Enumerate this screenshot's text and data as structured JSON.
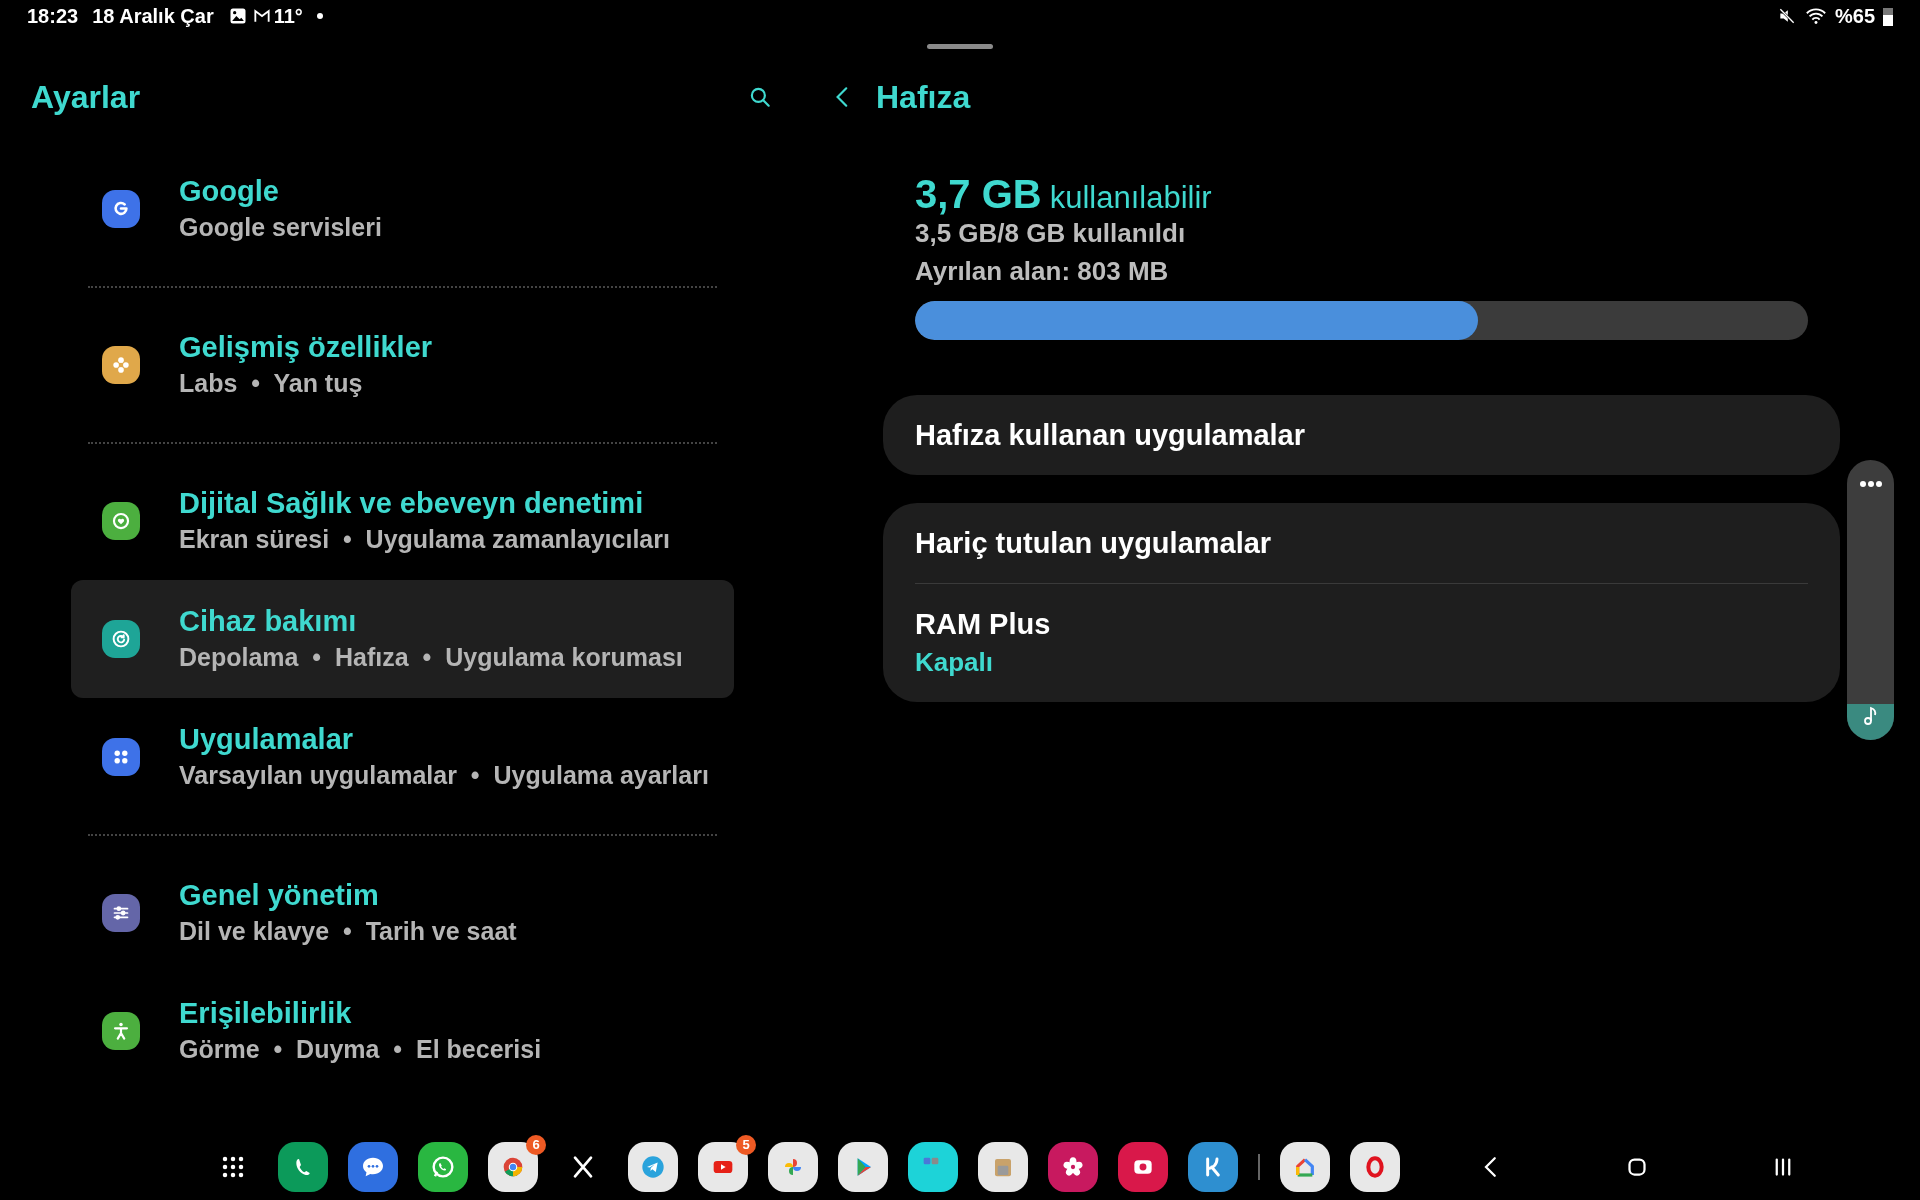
{
  "status_bar": {
    "time": "18:23",
    "date": "18 Aralık Çar",
    "temperature": "11°",
    "battery": "%65"
  },
  "settings": {
    "title": "Ayarlar",
    "groups": [
      {
        "items": [
          {
            "kind": "google",
            "title": "Google",
            "subtitle": "Google servisleri",
            "selected": false
          }
        ]
      },
      {
        "items": [
          {
            "kind": "advanced",
            "title": "Gelişmiş özellikler",
            "subtitle": "Labs  •  Yan tuş",
            "selected": false
          }
        ]
      },
      {
        "items": [
          {
            "kind": "wellbeing",
            "title": "Dijital Sağlık ve ebeveyn denetimi",
            "subtitle": "Ekran süresi  •  Uygulama zamanlayıcıları",
            "selected": false
          },
          {
            "kind": "care",
            "title": "Cihaz bakımı",
            "subtitle": "Depolama  •  Hafıza  •  Uygulama koruması",
            "selected": true
          },
          {
            "kind": "apps",
            "title": "Uygulamalar",
            "subtitle": "Varsayılan uygulamalar  •  Uygulama ayarları",
            "selected": false
          }
        ]
      },
      {
        "items": [
          {
            "kind": "general",
            "title": "Genel yönetim",
            "subtitle": "Dil ve klavye  •  Tarih ve saat",
            "selected": false
          },
          {
            "kind": "accessibility",
            "title": "Erişilebilirlik",
            "subtitle": "Görme  •  Duyma  •  El becerisi",
            "selected": false
          }
        ]
      }
    ]
  },
  "detail": {
    "title": "Hafıza",
    "available_amount": "3,7 GB",
    "available_label": "kullanılabilir",
    "used": "3,5 GB/8 GB kullanıldı",
    "reserved": "Ayrılan alan: 803 MB",
    "level": 0.63,
    "cards": [
      {
        "rows": [
          {
            "title": "Hafıza kullanan uygulamalar"
          }
        ]
      },
      {
        "rows": [
          {
            "title": "Hariç tutulan uygulamalar"
          },
          {
            "title": "RAM Plus",
            "value": "Kapalı"
          }
        ]
      }
    ]
  },
  "taskbar": {
    "apps": [
      {
        "kind": "grid"
      },
      {
        "kind": "phone"
      },
      {
        "kind": "messages"
      },
      {
        "kind": "whatsapp"
      },
      {
        "kind": "chrome",
        "badge": "6"
      },
      {
        "kind": "x"
      },
      {
        "kind": "telegram"
      },
      {
        "kind": "youtube",
        "badge": "5"
      },
      {
        "kind": "photos"
      },
      {
        "kind": "play"
      },
      {
        "kind": "folder"
      },
      {
        "kind": "files"
      },
      {
        "kind": "blossom"
      },
      {
        "kind": "camera"
      },
      {
        "kind": "k"
      }
    ],
    "recent_apps": [
      {
        "kind": "home"
      },
      {
        "kind": "opera"
      }
    ],
    "nav": [
      {
        "kind": "back"
      },
      {
        "kind": "home"
      },
      {
        "kind": "recents"
      }
    ]
  }
}
